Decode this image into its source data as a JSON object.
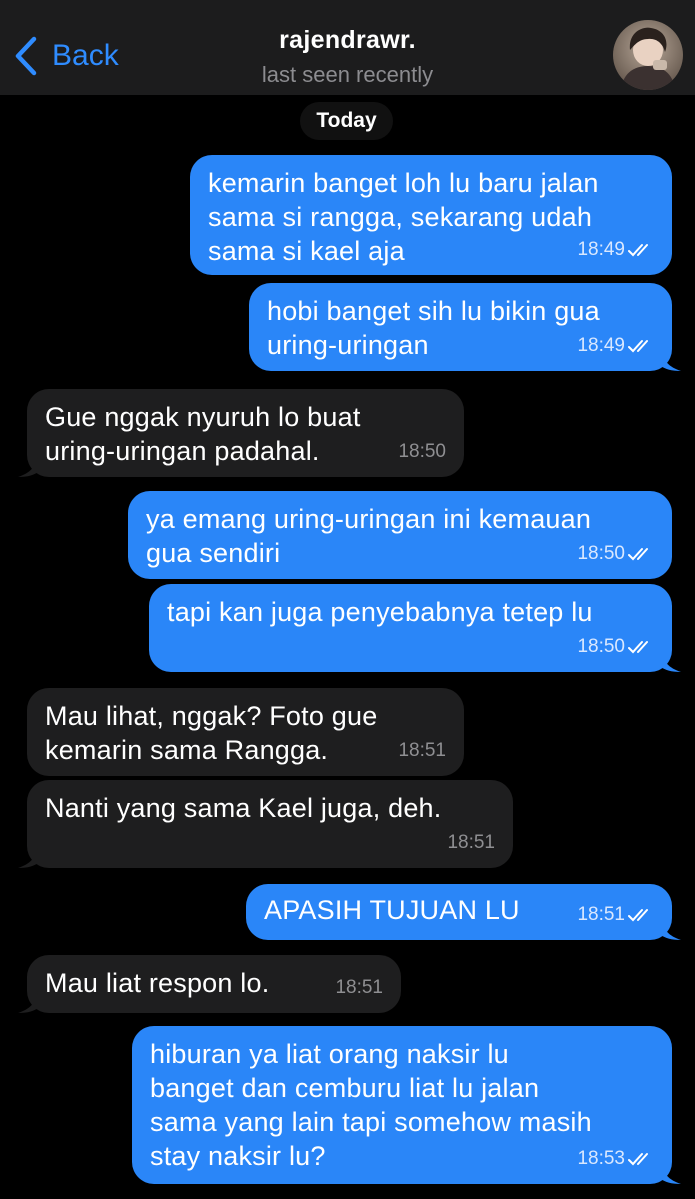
{
  "header": {
    "back_label": "Back",
    "contact_name": "rajendrawr.",
    "status": "last seen recently"
  },
  "date_separator": "Today",
  "messages": [
    {
      "direction": "outgoing",
      "lines": [
        "kemarin banget loh lu baru jalan",
        "sama si rangga, sekarang udah",
        "sama si kael aja"
      ],
      "time": "18:49",
      "read": true
    },
    {
      "direction": "outgoing",
      "lines": [
        "hobi banget sih lu bikin gua",
        "uring-uringan"
      ],
      "time": "18:49",
      "read": true
    },
    {
      "direction": "incoming",
      "lines": [
        "Gue nggak nyuruh lo buat",
        "uring-uringan padahal."
      ],
      "time": "18:50"
    },
    {
      "direction": "outgoing",
      "lines": [
        "ya emang uring-uringan ini kemauan",
        "gua sendiri"
      ],
      "time": "18:50",
      "read": true
    },
    {
      "direction": "outgoing",
      "lines": [
        "tapi kan juga penyebabnya tetep lu"
      ],
      "time": "18:50",
      "read": true
    },
    {
      "direction": "incoming",
      "lines": [
        "Mau lihat, nggak? Foto gue",
        "kemarin sama Rangga."
      ],
      "time": "18:51"
    },
    {
      "direction": "incoming",
      "lines": [
        "Nanti yang sama Kael juga, deh."
      ],
      "time": "18:51"
    },
    {
      "direction": "outgoing",
      "lines": [
        "APASIH TUJUAN LU"
      ],
      "time": "18:51",
      "read": true
    },
    {
      "direction": "incoming",
      "lines": [
        "Mau liat respon lo."
      ],
      "time": "18:51"
    },
    {
      "direction": "outgoing",
      "lines": [
        "hiburan ya liat orang naksir lu",
        "banget dan cemburu liat lu jalan",
        "sama yang lain tapi somehow masih",
        "stay naksir lu?"
      ],
      "time": "18:53",
      "read": true
    }
  ],
  "colors": {
    "outgoing_bubble": "#2a86f8",
    "incoming_bubble": "#1e1e1f",
    "accent": "#2f8cff",
    "background": "#000000"
  },
  "icons": {
    "back": "chevron-left-icon",
    "read": "double-check-icon"
  }
}
